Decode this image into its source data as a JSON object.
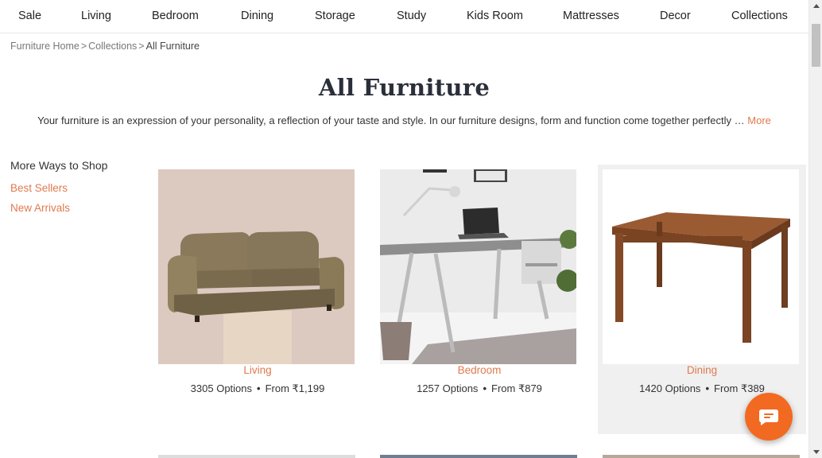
{
  "nav": {
    "items": [
      "Sale",
      "Living",
      "Bedroom",
      "Dining",
      "Storage",
      "Study",
      "Kids Room",
      "Mattresses",
      "Decor",
      "Collections"
    ]
  },
  "breadcrumb": {
    "items": [
      "Furniture Home",
      "Collections",
      "All Furniture"
    ],
    "separator": ">"
  },
  "page": {
    "title": "All Furniture",
    "intro": "Your furniture is an expression of your personality, a reflection of your taste and style. In our furniture designs, form and function come together perfectly …",
    "more_label": "More"
  },
  "sidebar": {
    "heading": "More Ways to Shop",
    "links": [
      "Best Sellers",
      "New Arrivals"
    ]
  },
  "cards": [
    {
      "title": "Living",
      "options": "3305 Options",
      "price": "From ₹1,199",
      "icon": "sofa-image"
    },
    {
      "title": "Bedroom",
      "options": "1257 Options",
      "price": "From ₹879",
      "icon": "study-desk-image"
    },
    {
      "title": "Dining",
      "options": "1420 Options",
      "price": "From ₹389",
      "icon": "dining-table-image"
    }
  ],
  "meta_separator": "•",
  "colors": {
    "accent": "#e07a4f",
    "chat": "#f26a21",
    "heading": "#2b2f3a"
  },
  "chat": {
    "icon": "chat-bubble-icon"
  }
}
